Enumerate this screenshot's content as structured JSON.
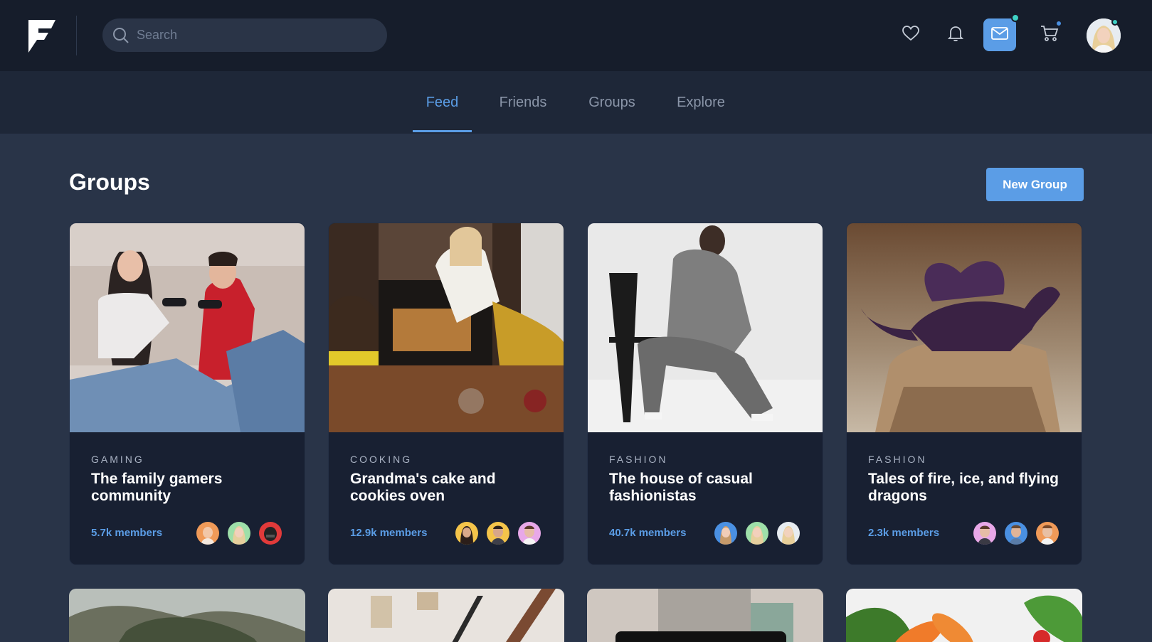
{
  "search": {
    "placeholder": "Search"
  },
  "header": {
    "icons": [
      "heart-icon",
      "bell-icon",
      "mail-icon",
      "cart-icon"
    ],
    "accent": "#5b9de6",
    "notification_color": "#3fd1c5"
  },
  "nav": {
    "tabs": [
      {
        "label": "Feed",
        "active": true
      },
      {
        "label": "Friends",
        "active": false
      },
      {
        "label": "Groups",
        "active": false
      },
      {
        "label": "Explore",
        "active": false
      }
    ]
  },
  "page": {
    "title": "Groups",
    "new_group_label": "New Group"
  },
  "groups": [
    {
      "category": "GAMING",
      "name": "The family gamers community",
      "members": "5.7k members"
    },
    {
      "category": "COOKING",
      "name": "Grandma's cake and cookies oven",
      "members": "12.9k members"
    },
    {
      "category": "FASHION",
      "name": "The house of casual fashionistas",
      "members": "40.7k members"
    },
    {
      "category": "FASHION",
      "name": "Tales of fire, ice, and flying dragons",
      "members": "2.3k members"
    }
  ]
}
